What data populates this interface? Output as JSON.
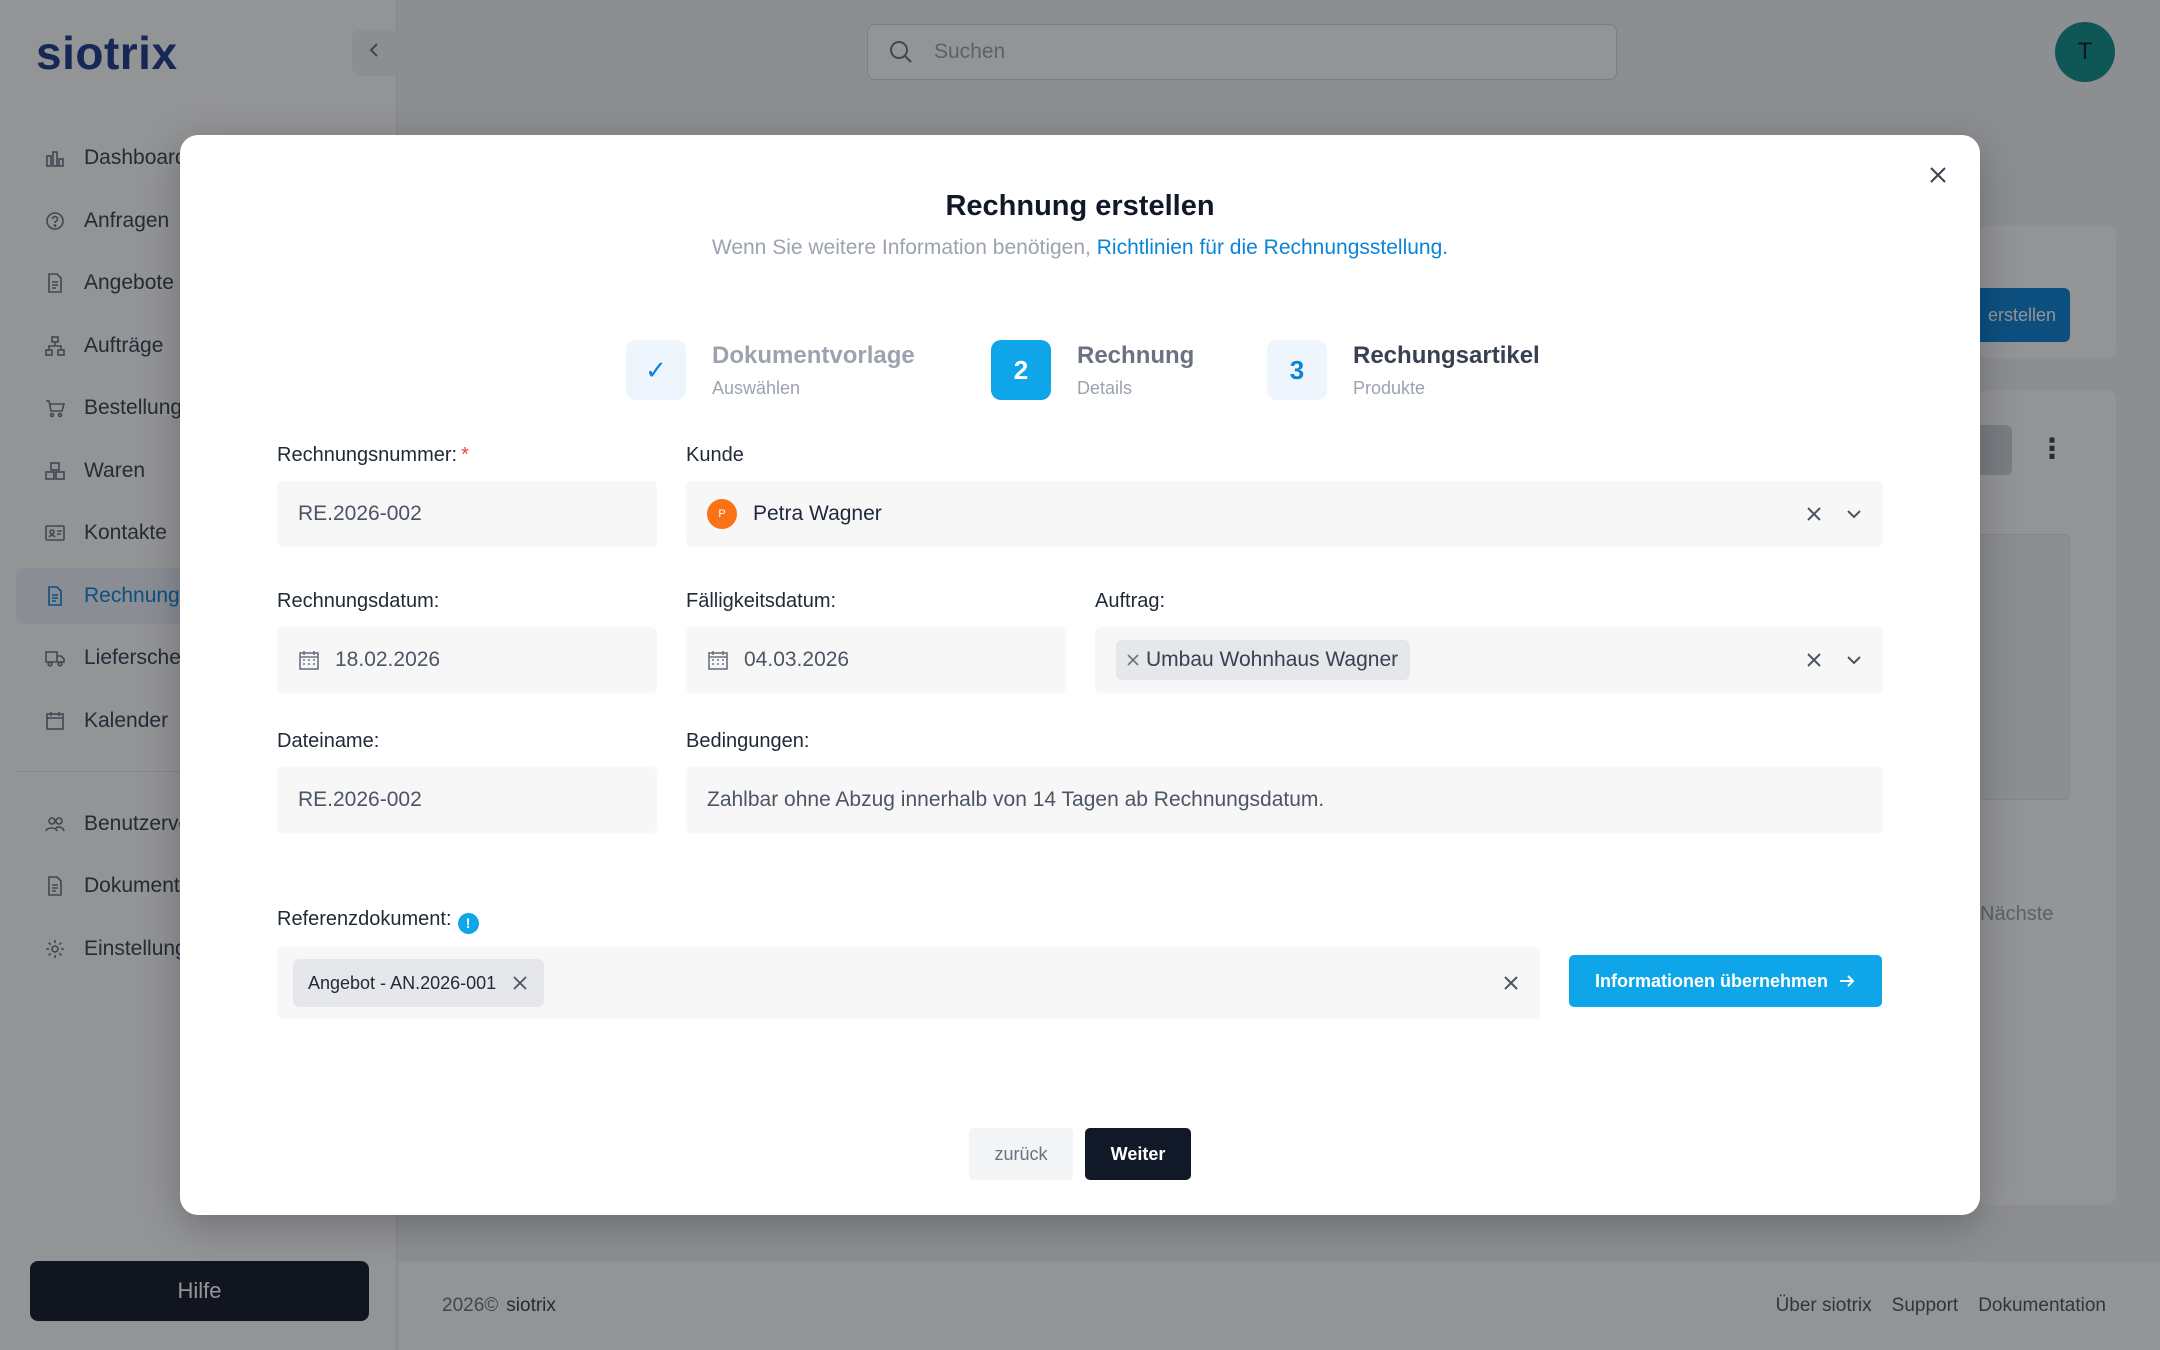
{
  "app": {
    "logo": "siotrix",
    "search_placeholder": "Suchen",
    "user_initial": "T"
  },
  "sidebar": {
    "items": [
      {
        "label": "Dashboard",
        "icon": "chart-icon"
      },
      {
        "label": "Anfragen",
        "icon": "question-icon"
      },
      {
        "label": "Angebote",
        "icon": "document-icon"
      },
      {
        "label": "Aufträge",
        "icon": "hierarchy-icon"
      },
      {
        "label": "Bestellungen",
        "icon": "cart-icon"
      },
      {
        "label": "Waren",
        "icon": "boxes-icon"
      },
      {
        "label": "Kontakte",
        "icon": "contact-card-icon"
      },
      {
        "label": "Rechnungen",
        "icon": "invoice-icon",
        "active": true
      },
      {
        "label": "Lieferscheine",
        "icon": "truck-icon"
      },
      {
        "label": "Kalender",
        "icon": "calendar-icon"
      }
    ],
    "secondary_items": [
      {
        "label": "Benutzerverwaltung",
        "icon": "users-icon"
      },
      {
        "label": "Dokumente",
        "icon": "document-icon"
      },
      {
        "label": "Einstellungen",
        "icon": "gear-icon"
      }
    ],
    "help_label": "Hilfe"
  },
  "background": {
    "create_button": "erstellen",
    "next_label": "Nächste"
  },
  "footer": {
    "copyright": "2026©",
    "brand": "siotrix",
    "links": [
      "Über siotrix",
      "Support",
      "Dokumentation"
    ]
  },
  "modal": {
    "title": "Rechnung erstellen",
    "subtitle_prefix": "Wenn Sie weitere Information benötigen,",
    "subtitle_link": "Richtlinien für die Rechnungsstellung.",
    "steps": [
      {
        "badge": "✓",
        "title": "Dokumentvorlage",
        "subtitle": "Auswählen",
        "state": "done"
      },
      {
        "badge": "2",
        "title": "Rechnung",
        "subtitle": "Details",
        "state": "current"
      },
      {
        "badge": "3",
        "title": "Rechungsartikel",
        "subtitle": "Produkte",
        "state": "upcoming"
      }
    ],
    "fields": {
      "invoice_number": {
        "label": "Rechnungsnummer:",
        "required_mark": "*",
        "value": "RE.2026-002"
      },
      "customer": {
        "label": "Kunde",
        "avatar_initial": "P",
        "value": "Petra Wagner"
      },
      "invoice_date": {
        "label": "Rechnungsdatum:",
        "value": "18.02.2026"
      },
      "due_date": {
        "label": "Fälligkeitsdatum:",
        "value": "04.03.2026"
      },
      "order": {
        "label": "Auftrag:",
        "chip": "Umbau Wohnhaus Wagner"
      },
      "filename": {
        "label": "Dateiname:",
        "value": "RE.2026-002"
      },
      "conditions": {
        "label": "Bedingungen:",
        "value": "Zahlbar ohne Abzug innerhalb von 14 Tagen ab Rechnungsdatum."
      },
      "reference": {
        "label": "Referenzdokument:",
        "info_icon": "!",
        "chip": "Angebot - AN.2026-001"
      }
    },
    "apply_button": "Informationen übernehmen",
    "back_button": "zurück",
    "next_button": "Weiter"
  },
  "colors": {
    "accent": "#0ea5e9",
    "brand": "#1e3a8a",
    "dark": "#111827",
    "required": "#ef4444"
  }
}
